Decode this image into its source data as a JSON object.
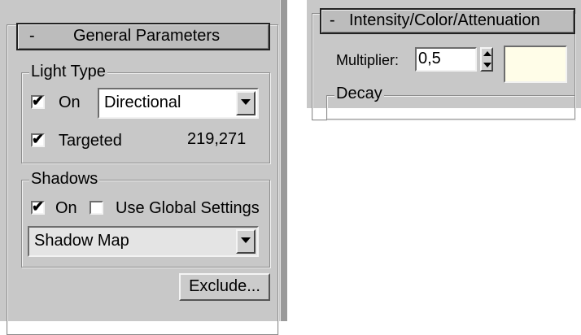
{
  "general_parameters": {
    "collapse_symbol": "-",
    "title": "General Parameters",
    "light_type": {
      "label": "Light Type",
      "on_label": "On",
      "on_checked": true,
      "type_value": "Directional",
      "targeted_label": "Targeted",
      "targeted_checked": true,
      "targeted_distance": "219,271"
    },
    "shadows": {
      "label": "Shadows",
      "on_label": "On",
      "on_checked": true,
      "use_global_label": "Use Global Settings",
      "use_global_checked": false,
      "shadow_type_value": "Shadow Map"
    },
    "exclude_label": "Exclude..."
  },
  "intensity_panel": {
    "collapse_symbol": "-",
    "title": "Intensity/Color/Attenuation",
    "multiplier_label": "Multiplier:",
    "multiplier_value": "0,5",
    "color_swatch": "#fffde8",
    "decay_label": "Decay"
  },
  "colors": {
    "panel_bg": "#c8c8c8",
    "check_mark": "#000000"
  }
}
